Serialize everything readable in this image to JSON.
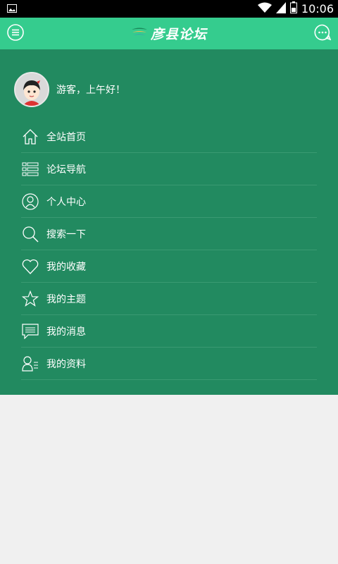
{
  "status_bar": {
    "time": "10:06",
    "icons": [
      "image-notification-icon",
      "wifi-icon",
      "signal-icon",
      "battery-icon"
    ]
  },
  "app_bar": {
    "title": "彦县论坛",
    "left_icon": "menu-icon",
    "right_icon": "chat-bubble-icon",
    "color": "#35cc8e"
  },
  "drawer": {
    "background": "#228a60",
    "greeting": "游客，上午好！",
    "menu": [
      {
        "label": "全站首页",
        "icon": "home-icon"
      },
      {
        "label": "论坛导航",
        "icon": "list-icon"
      },
      {
        "label": "个人中心",
        "icon": "person-icon"
      },
      {
        "label": "搜索一下",
        "icon": "search-icon"
      },
      {
        "label": "我的收藏",
        "icon": "heart-icon"
      },
      {
        "label": "我的主题",
        "icon": "star-icon"
      },
      {
        "label": "我的消息",
        "icon": "message-icon"
      },
      {
        "label": "我的资料",
        "icon": "profile-icon"
      }
    ]
  }
}
